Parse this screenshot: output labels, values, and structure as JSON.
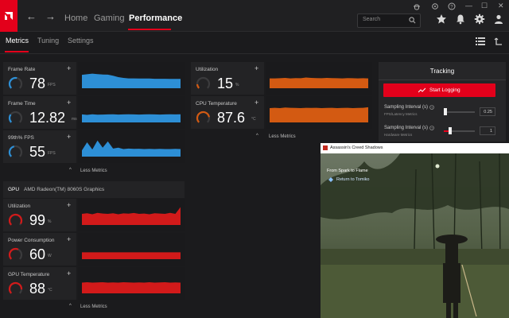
{
  "topnav": {
    "items": [
      "Home",
      "Gaming",
      "Performance"
    ],
    "active": "Performance",
    "search_placeholder": "Search"
  },
  "window_controls": [
    "—",
    "☐",
    "✕"
  ],
  "subnav": {
    "tabs": [
      "Metrics",
      "Tuning",
      "Settings"
    ],
    "active": "Metrics"
  },
  "cpu_metrics": [
    {
      "title": "Frame Rate",
      "value": "78",
      "unit": "FPS",
      "level": 0.55,
      "color": "#2d8fd6"
    },
    {
      "title": "Frame Time",
      "value": "12.82",
      "unit": "ms",
      "level": 0.3,
      "color": "#2d8fd6"
    },
    {
      "title": "99th% FPS",
      "value": "55",
      "unit": "FPS",
      "level": 0.45,
      "color": "#2d8fd6"
    }
  ],
  "cpu_right_metrics": [
    {
      "title": "Utilization",
      "value": "15",
      "unit": "%",
      "level": 0.15,
      "color": "#d35a12"
    },
    {
      "title": "CPU Temperature",
      "value": "87.6",
      "unit": "°C",
      "level": 0.8,
      "color": "#d35a12"
    }
  ],
  "less_metrics_label": "Less Metrics",
  "gpu": {
    "label": "GPU",
    "name": "AMD Radeon(TM) 8060S Graphics",
    "metrics": [
      {
        "title": "Utilization",
        "value": "99",
        "unit": "%",
        "level": 0.95,
        "color": "#d21a1a"
      },
      {
        "title": "Power Consumption",
        "value": "60",
        "unit": "W",
        "level": 0.6,
        "color": "#d21a1a"
      },
      {
        "title": "GPU Temperature",
        "value": "88",
        "unit": "°C",
        "level": 0.85,
        "color": "#d21a1a"
      }
    ]
  },
  "tracking": {
    "title": "Tracking",
    "start_label": "Start Logging",
    "intervals": [
      {
        "label": "Sampling Interval (s)",
        "sub": "FPS/Latency Metrics",
        "value": "0.25",
        "level": 0.05
      },
      {
        "label": "Sampling Interval (s)",
        "sub": "Hardware Metrics",
        "value": "1",
        "level": 0.2
      }
    ]
  },
  "game_window": {
    "title": "Assassin's Creed Shadows",
    "objective": "From Spark to Flame",
    "quest": "Return to Tomiko"
  },
  "colors": {
    "accent": "#e3001b",
    "blue": "#2d8fd6",
    "orange": "#d35a12",
    "red": "#d21a1a"
  }
}
